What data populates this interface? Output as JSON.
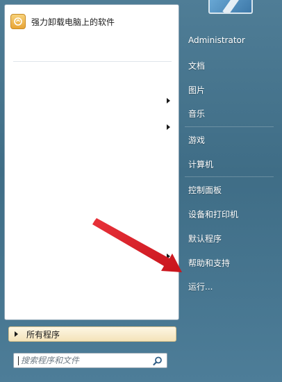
{
  "left_panel": {
    "pinned_app": {
      "label": "强力卸载电脑上的软件",
      "icon": "uninstaller-box-icon"
    },
    "submenu_arrows": [
      "chevron-right-icon",
      "chevron-right-icon",
      "chevron-right-icon"
    ]
  },
  "all_programs": {
    "label": "所有程序"
  },
  "search": {
    "placeholder": "搜索程序和文件",
    "icon": "search-icon"
  },
  "right_panel": {
    "user_name": "Administrator",
    "items": [
      {
        "label": "文档"
      },
      {
        "label": "图片"
      },
      {
        "label": "音乐"
      },
      {
        "label": "游戏"
      },
      {
        "label": "计算机"
      },
      {
        "label": "控制面板"
      },
      {
        "label": "设备和打印机"
      },
      {
        "label": "默认程序"
      },
      {
        "label": "帮助和支持"
      },
      {
        "label": "运行..."
      }
    ]
  },
  "colors": {
    "panel_background": "#4f7d96",
    "annotation_arrow": "#e0202a"
  }
}
